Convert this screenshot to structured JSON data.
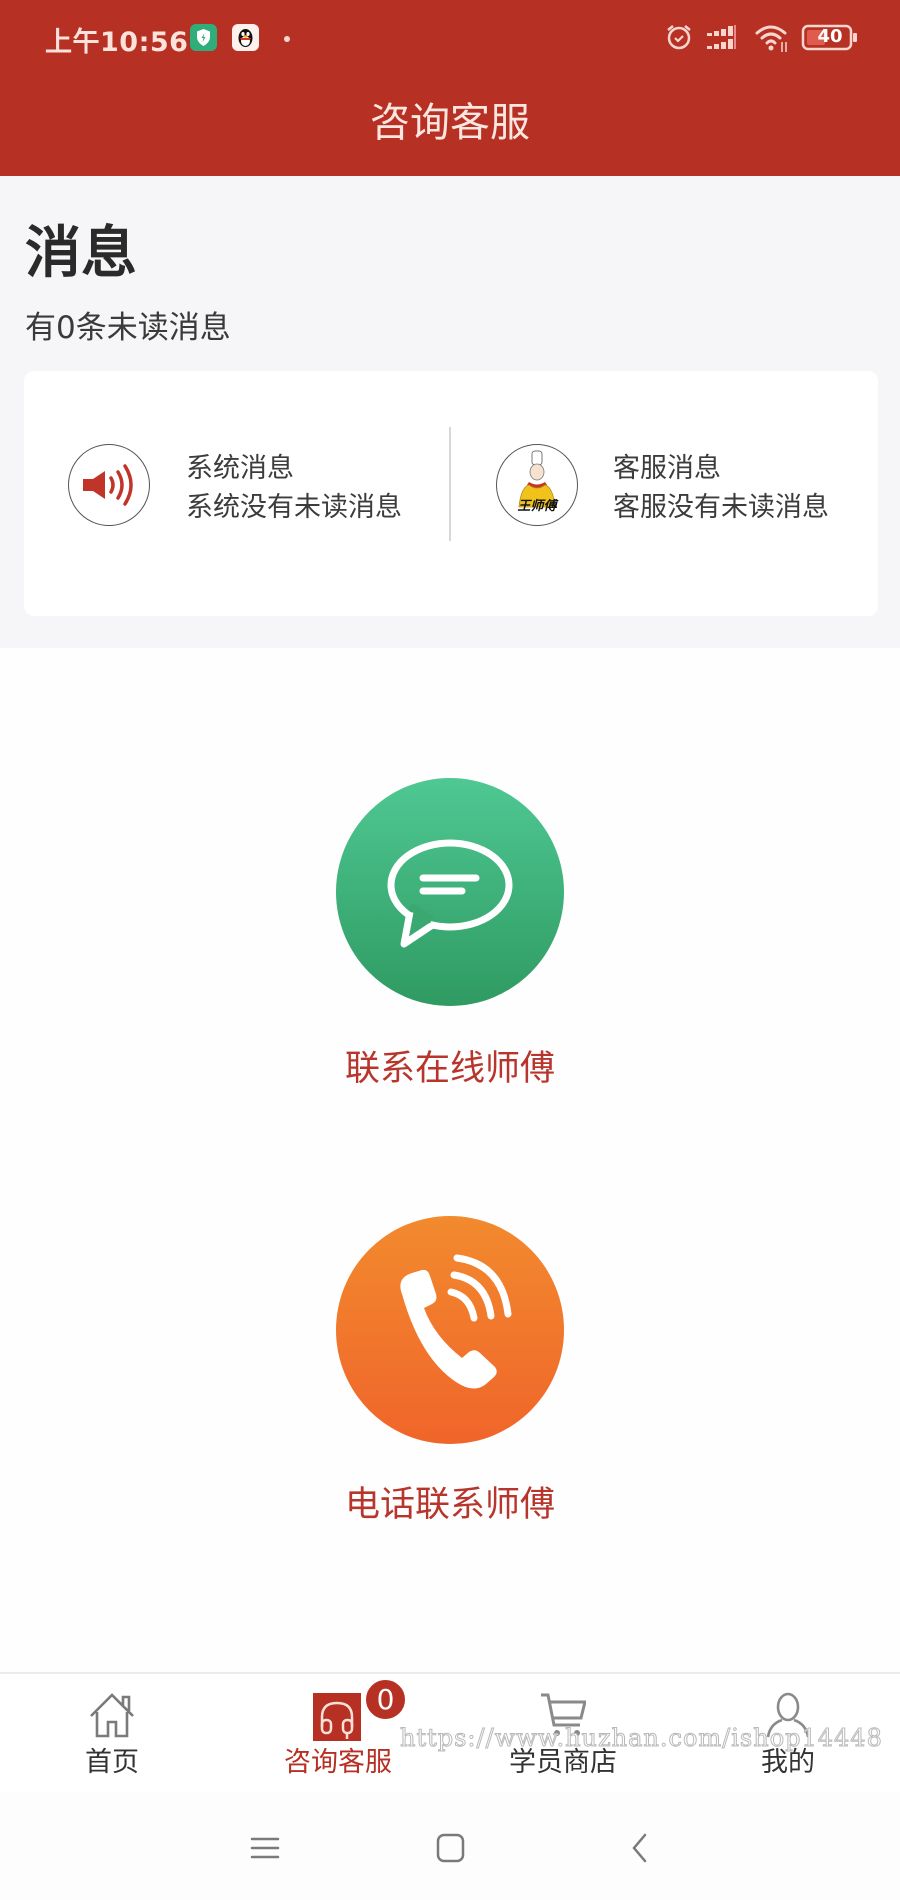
{
  "status_bar": {
    "time": "上午10:56",
    "icons": [
      "security-app-icon",
      "qq-app-icon",
      "notification-dot",
      "alarm-icon",
      "signal-icon",
      "wifi-icon",
      "battery-icon"
    ],
    "battery_level": "40"
  },
  "header": {
    "title": "咨询客服"
  },
  "messages": {
    "title": "消息",
    "unread_summary": "有0条未读消息",
    "items": [
      {
        "icon": "speaker-icon",
        "title": "系统消息",
        "subtitle": "系统没有未读消息"
      },
      {
        "icon": "chef-avatar",
        "avatar_text": "王师傅",
        "title": "客服消息",
        "subtitle": "客服没有未读消息"
      }
    ]
  },
  "actions": [
    {
      "icon": "chat-bubble-icon",
      "label": "联系在线师傅",
      "color": "#3db37a"
    },
    {
      "icon": "phone-icon",
      "label": "电话联系师傅",
      "color": "#f07a2c"
    }
  ],
  "tabbar": {
    "tabs": [
      {
        "icon": "home-icon",
        "label": "首页",
        "active": false
      },
      {
        "icon": "headset-icon",
        "label": "咨询客服",
        "active": true,
        "badge": "0"
      },
      {
        "icon": "cart-icon",
        "label": "学员商店",
        "active": false
      },
      {
        "icon": "user-icon",
        "label": "我的",
        "active": false
      }
    ]
  },
  "watermark": "https://www.huzhan.com/ishop14448",
  "system_nav": [
    "menu-icon",
    "home-square-icon",
    "back-icon"
  ],
  "colors": {
    "brand_red": "#b73024",
    "label_red": "#b8352c",
    "green": "#3db37a",
    "orange": "#f07a2c"
  }
}
